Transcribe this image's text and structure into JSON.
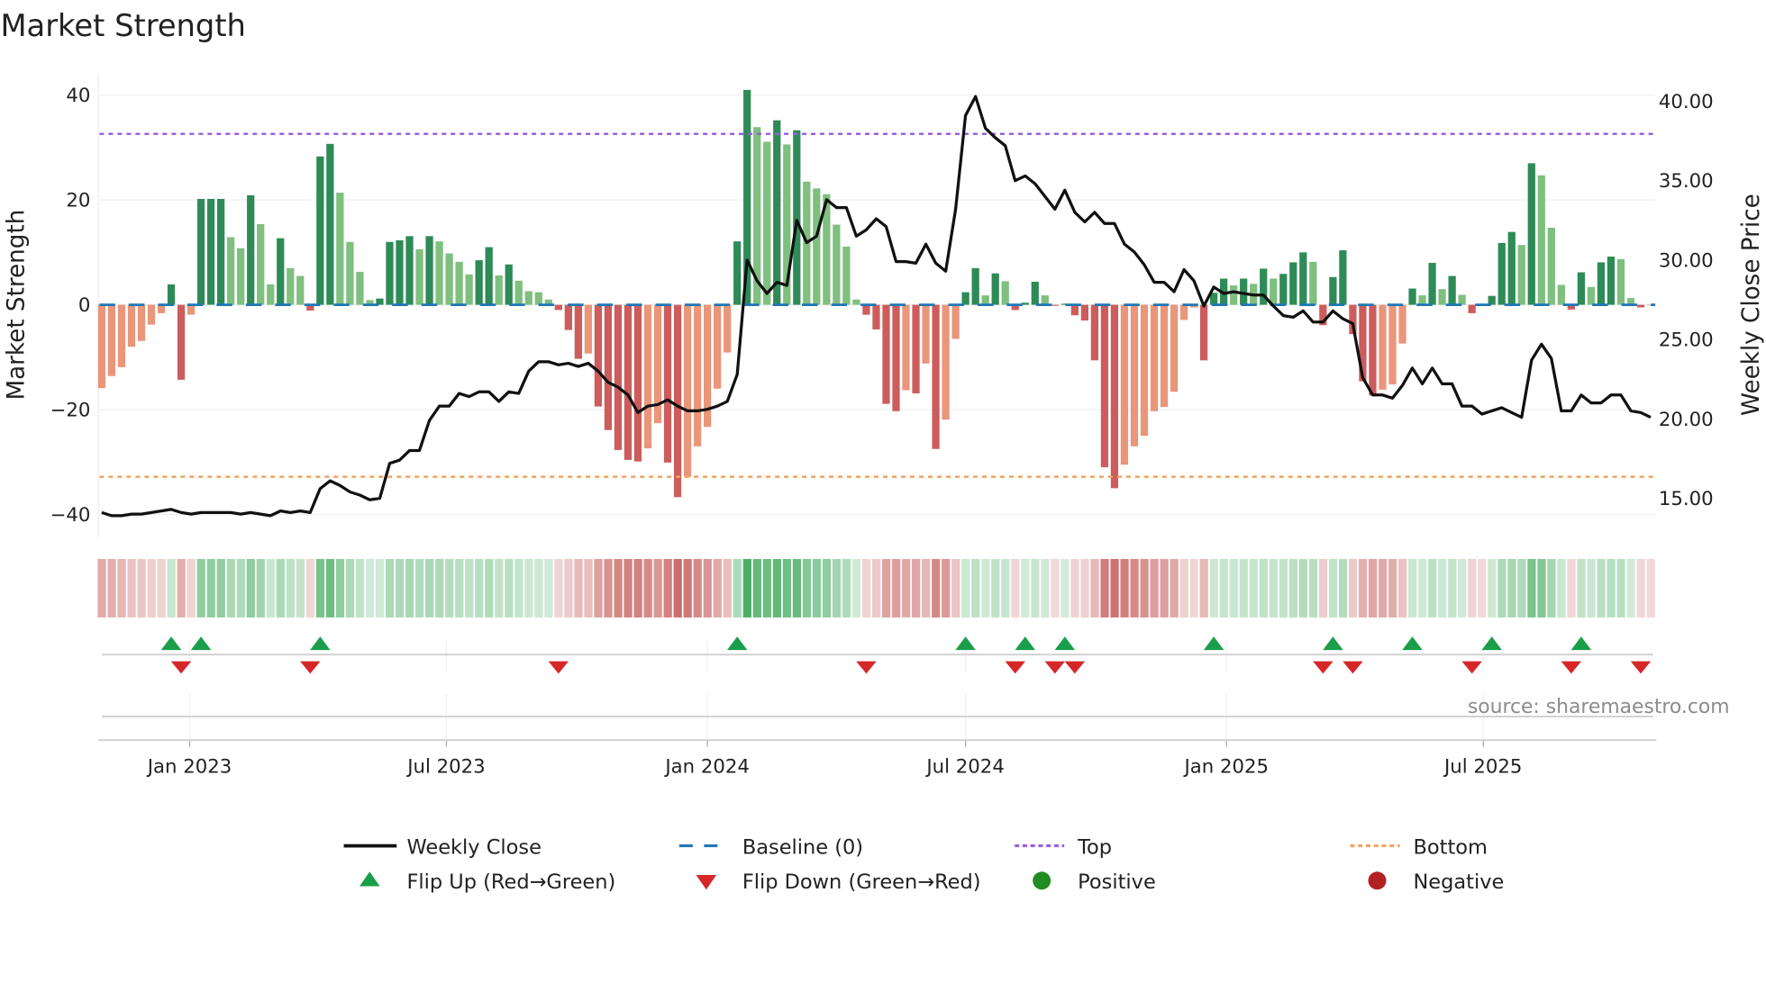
{
  "chart_data": {
    "type": "bar",
    "title": "Market Strength",
    "ylabel": "Market Strength",
    "y2label": "Weekly Close Price",
    "ylim": [
      -44,
      44
    ],
    "y2lim": [
      13.4,
      41.4
    ],
    "start_date": "2022-10-31",
    "frequency": "weekly",
    "top_level": 32.6,
    "bottom_level": -32.8,
    "baseline": 0,
    "left_ticks": [
      {
        "value": 40,
        "label": "40"
      },
      {
        "value": 20,
        "label": "20"
      },
      {
        "value": 0,
        "label": "0"
      },
      {
        "value": -20,
        "label": "−20"
      },
      {
        "value": -40,
        "label": "−40"
      }
    ],
    "right_ticks": [
      {
        "value": 40,
        "label": "40.00"
      },
      {
        "value": 35,
        "label": "35.00"
      },
      {
        "value": 30,
        "label": "30.00"
      },
      {
        "value": 25,
        "label": "25.00"
      },
      {
        "value": 20,
        "label": "20.00"
      },
      {
        "value": 15,
        "label": "15.00"
      }
    ],
    "x_ticks": [
      {
        "date": "2023-01-01",
        "label": "Jan 2023"
      },
      {
        "date": "2023-07-01",
        "label": "Jul 2023"
      },
      {
        "date": "2024-01-01",
        "label": "Jan 2024"
      },
      {
        "date": "2024-07-01",
        "label": "Jul 2024"
      },
      {
        "date": "2025-01-01",
        "label": "Jan 2025"
      },
      {
        "date": "2025-07-01",
        "label": "Jul 2025"
      }
    ],
    "strength": [
      -15.9,
      -13.6,
      -11.9,
      -8,
      -6.9,
      -3.8,
      -1.6,
      3.9,
      -14.3,
      -1.9,
      20.2,
      20.2,
      20.2,
      12.9,
      10.8,
      20.9,
      15.4,
      3.9,
      12.7,
      7,
      5.5,
      -1.1,
      28.3,
      30.7,
      21.4,
      12,
      6.3,
      0.9,
      1.2,
      12,
      12.3,
      13.1,
      10.6,
      13.1,
      12.1,
      9.8,
      8.2,
      5.8,
      8.5,
      11,
      5.6,
      7.7,
      4.6,
      2.6,
      2.4,
      1,
      -1,
      -4.8,
      -10.3,
      -9.3,
      -19.4,
      -23.9,
      -27.7,
      -29.6,
      -29.9,
      -27.4,
      -22.6,
      -30.1,
      -36.7,
      -32.8,
      -27,
      -23.3,
      -16,
      -9.1,
      12.1,
      41,
      33.9,
      31.1,
      35.2,
      30.6,
      33.3,
      23.5,
      22.2,
      21.1,
      15.3,
      11.1,
      1,
      -1.9,
      -4.7,
      -18.9,
      -20.3,
      -16.3,
      -16.9,
      -11.2,
      -27.5,
      -21.9,
      -6.5,
      2.4,
      7,
      1.8,
      6,
      4.5,
      -1,
      0.4,
      4.4,
      1.8,
      -0.2,
      0.2,
      -2,
      -3,
      -10.6,
      -31,
      -35,
      -30.5,
      -27,
      -25,
      -20.3,
      -19.5,
      -16.6,
      -2.9,
      -0.5,
      -10.6,
      2.3,
      5,
      3.7,
      5,
      4,
      6.9,
      5,
      5.9,
      8.1,
      10,
      8.2,
      -3.9,
      5.3,
      10.4,
      -5.6,
      -14.6,
      -17.3,
      -16.2,
      -15.2,
      -7.4,
      3.1,
      1.8,
      8,
      3,
      5.5,
      1.9,
      -1.6,
      0,
      1.7,
      11.8,
      13.9,
      11.4,
      27,
      24.7,
      14.7,
      3.8,
      -0.9,
      6.2,
      3.4,
      8.1,
      9.2,
      8.7,
      1.3,
      -0.5,
      -0.1
    ],
    "weekly_close": [
      14.1,
      13.9,
      13.9,
      14.0,
      14.0,
      14.1,
      14.2,
      14.3,
      14.1,
      14.0,
      14.1,
      14.1,
      14.1,
      14.1,
      14.0,
      14.1,
      14.0,
      13.9,
      14.2,
      14.1,
      14.2,
      14.1,
      15.6,
      16.1,
      15.8,
      15.4,
      15.2,
      14.9,
      15.0,
      17.2,
      17.4,
      18.0,
      18.0,
      19.9,
      20.8,
      20.8,
      21.6,
      21.4,
      21.7,
      21.7,
      21.1,
      21.7,
      21.6,
      23.0,
      23.6,
      23.6,
      23.4,
      23.5,
      23.3,
      23.5,
      23.0,
      22.3,
      22.0,
      21.5,
      20.4,
      20.8,
      20.9,
      21.2,
      20.8,
      20.5,
      20.5,
      20.6,
      20.8,
      21.1,
      22.8,
      30.0,
      28.7,
      27.9,
      28.6,
      28.4,
      32.5,
      31.1,
      31.5,
      33.8,
      33.3,
      33.3,
      31.5,
      31.9,
      32.6,
      32.1,
      29.9,
      29.9,
      29.8,
      31.0,
      29.8,
      29.3,
      33.2,
      39.1,
      40.3,
      38.3,
      37.7,
      37.2,
      35.0,
      35.3,
      34.8,
      34.0,
      33.2,
      34.4,
      33.0,
      32.4,
      33.0,
      32.3,
      32.3,
      31.0,
      30.5,
      29.7,
      28.6,
      28.6,
      28.0,
      29.4,
      28.7,
      27.1,
      28.3,
      27.9,
      28.0,
      27.9,
      27.8,
      27.8,
      27.1,
      26.5,
      26.4,
      26.8,
      26.1,
      26.1,
      26.8,
      26.3,
      26.0,
      22.6,
      21.5,
      21.5,
      21.3,
      22.1,
      23.2,
      22.2,
      23.2,
      22.2,
      22.2,
      20.8,
      20.8,
      20.3,
      20.5,
      20.7,
      20.4,
      20.1,
      23.7,
      24.7,
      23.8,
      20.5,
      20.5,
      21.5,
      21.0,
      21.0,
      21.5,
      21.5,
      20.5,
      20.4,
      20.1
    ],
    "legend": {
      "weekly_close": "Weekly Close",
      "baseline": "Baseline (0)",
      "top": "Top",
      "bottom": "Bottom",
      "flip_up": "Flip Up (Red→Green)",
      "flip_down": "Flip Down (Green→Red)",
      "positive": "Positive",
      "negative": "Negative"
    },
    "legend_placement": "bottom-center",
    "grid": true,
    "source": "source: sharemaestro.com"
  },
  "colors": {
    "rising_positive": "#2e8b57",
    "falling_positive": "#7fbf7f",
    "falling_negative": "#cd5c5c",
    "rising_negative": "#e9967a",
    "close_line": "#111111",
    "baseline": "#1f77b4",
    "top": "#9b5de5",
    "bottom": "#f0a35e",
    "flip_up": "#1a9e4a",
    "flip_down": "#d62728",
    "positive_dot": "#228b22",
    "negative_dot": "#b22222",
    "heat_positive": "#3aa655",
    "heat_negative": "#c0504d"
  }
}
